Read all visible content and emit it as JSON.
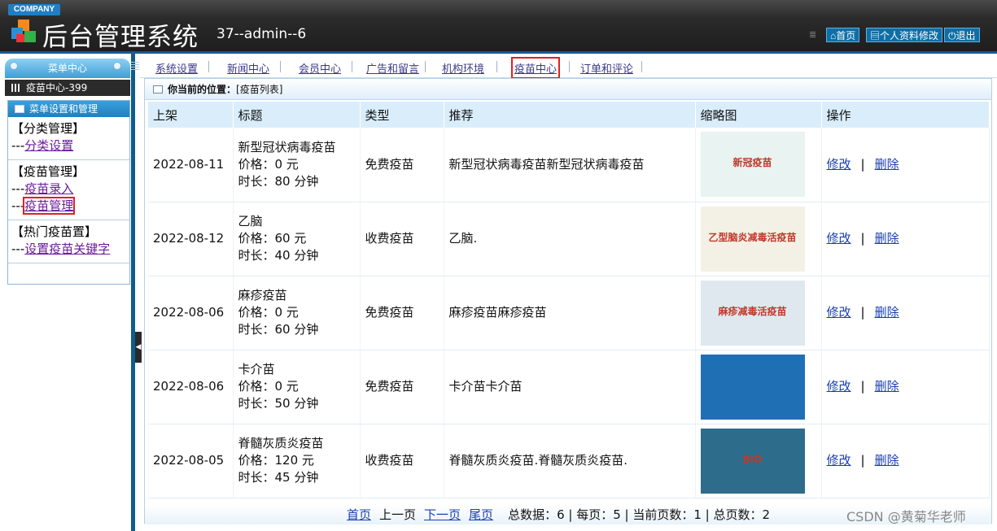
{
  "header": {
    "company": "COMPANY",
    "title": "后台管理系统",
    "user": "37--admin--6",
    "home": "首页",
    "profile": "个人资料修改",
    "logout": "退出"
  },
  "sidebar": {
    "menu_center": "菜单中心",
    "current": "疫苗中心-399",
    "panel_title": "菜单设置和管理",
    "groups": [
      {
        "title": "【分类管理】",
        "items": [
          {
            "prefix": "---",
            "label": "分类设置"
          }
        ]
      },
      {
        "title": "【疫苗管理】",
        "items": [
          {
            "prefix": "---",
            "label": "疫苗录入"
          },
          {
            "prefix": "---",
            "label": "疫苗管理"
          }
        ]
      },
      {
        "title": "【热门疫苗置】",
        "items": [
          {
            "prefix": "---",
            "label": "设置疫苗关键字"
          }
        ]
      }
    ]
  },
  "nav": {
    "tabs": [
      "系统设置",
      "新闻中心",
      "会员中心",
      "广告和留言",
      "机构环境",
      "疫苗中心",
      "订单和评论"
    ]
  },
  "breadcrumb": {
    "label": "你当前的位置：",
    "value": "[疫苗列表]"
  },
  "table": {
    "headers": [
      "上架",
      "标题",
      "类型",
      "推荐",
      "缩略图",
      "操作"
    ],
    "rows": [
      {
        "date": "2022-08-11",
        "title": "新型冠状病毒疫苗",
        "price": "价格：0 元",
        "duration": "时长：80 分钟",
        "type": "免费疫苗",
        "rec": "新型冠状病毒疫苗新型冠状病毒疫苗",
        "thumb_text": "新冠疫苗",
        "thumb_color": "#e9f3f1"
      },
      {
        "date": "2022-08-12",
        "title": "乙脑",
        "price": "价格：60 元",
        "duration": "时长：40 分钟",
        "type": "收费疫苗",
        "rec": "乙脑.",
        "thumb_text": "乙型脑炎减毒活疫苗",
        "thumb_color": "#f3f1e6"
      },
      {
        "date": "2022-08-06",
        "title": "麻疹疫苗",
        "price": "价格：0 元",
        "duration": "时长：60 分钟",
        "type": "免费疫苗",
        "rec": "麻疹疫苗麻疹疫苗",
        "thumb_text": "麻疹减毒活疫苗",
        "thumb_color": "#dfe8ef"
      },
      {
        "date": "2022-08-06",
        "title": "卡介苗",
        "price": "价格：0 元",
        "duration": "时长：50 分钟",
        "type": "免费疫苗",
        "rec": "卡介苗卡介苗",
        "thumb_text": "",
        "thumb_color": "#1f6fb5"
      },
      {
        "date": "2022-08-05",
        "title": "脊髓灰质炎疫苗",
        "price": "价格：120 元",
        "duration": "时长：45 分钟",
        "type": "收费疫苗",
        "rec": "脊髓灰质炎疫苗.脊髓灰质炎疫苗.",
        "thumb_text": "BIO",
        "thumb_color": "#2d6c8a"
      }
    ],
    "edit": "修改",
    "sep": "|",
    "delete": "删除"
  },
  "pager": {
    "first": "首页",
    "prev": "上一页",
    "next": "下一页",
    "last": "尾页",
    "total": "总数据：6 | 每页：5 | 当前页数：1 | 总页数：2"
  },
  "watermark": "CSDN @黄菊华老师",
  "colors": {
    "accent": "#0f5d8d",
    "header_bg": "#2b2b2b",
    "highlight": "#e02020"
  }
}
